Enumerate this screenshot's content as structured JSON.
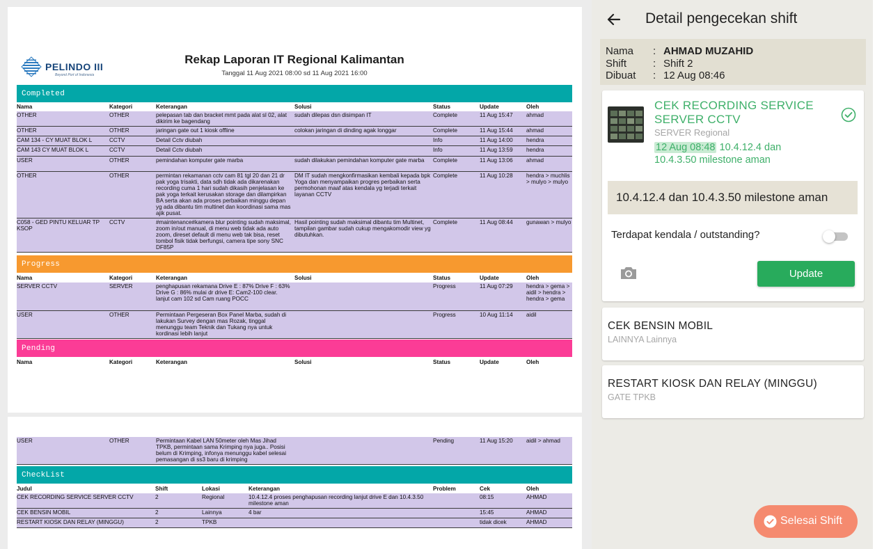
{
  "report": {
    "logo": {
      "name": "PELINDO III",
      "tagline": "Beyond Port of Indonesia"
    },
    "title": "Rekap Laporan IT Regional Kalimantan",
    "subtitle": "Tanggal 11 Aug 2021 08:00 sd 11 Aug 2021 16:00",
    "columns": {
      "nama": "Nama",
      "kategori": "Kategori",
      "keterangan": "Keterangan",
      "solusi": "Solusi",
      "status": "Status",
      "update": "Update",
      "oleh": "Oleh"
    },
    "sections": {
      "completed": {
        "label": "Completed",
        "rows": [
          {
            "nama": "OTHER",
            "kategori": "OTHER",
            "keterangan": "pelepasan tab dan bracket mmt pada alat sl 02, alat dikirim ke bagendang",
            "solusi": "sudah dilepas dsn disimpan IT",
            "status": "Complete",
            "update": "11 Aug 15:47",
            "oleh": "ahmad"
          },
          {
            "nama": "OTHER",
            "kategori": "OTHER",
            "keterangan": "jaringan gate out 1 kiosk offline",
            "solusi": "colokan jaringan di dinding agak longgar",
            "status": "Complete",
            "update": "11 Aug 15:44",
            "oleh": "ahmad"
          },
          {
            "nama": "CAM 134 - CY MUAT BLOK L",
            "kategori": "CCTV",
            "keterangan": "Detail Cctv diubah",
            "solusi": "",
            "status": "Info",
            "update": "11 Aug 14:00",
            "oleh": "hendra"
          },
          {
            "nama": "CAM 143 CY MUAT BLOK L",
            "kategori": "CCTV",
            "keterangan": "Detail Cctv diubah",
            "solusi": "",
            "status": "Info",
            "update": "11 Aug 13:59",
            "oleh": "hendra"
          },
          {
            "nama": "USER",
            "kategori": "OTHER",
            "keterangan": "pemindahan komputer gate marba",
            "solusi": "sudah dilakukan pemindahan komputer gate marba",
            "status": "Complete",
            "update": "11 Aug 13:06",
            "oleh": "ahmad"
          },
          {
            "nama": "OTHER",
            "kategori": "OTHER",
            "keterangan": "permintan rekamanan cctv cam 81 tgl 20 dan 21 dr pak yoga trisakti,  data sdh tidak ada dikarenakan recording cuma 1 hari sudah dikasih penjelasan ke pak yoga terkait kerusakan storage dan dilampirkan BA serta akan ada proses perbaikan minggu depan yg ada dibantu tim multinet dan koordinasi sama mas ajik pusat.",
            "solusi": "DM IT sudah mengkonfirmasikan kembali kepada bpk Yoga dan menyampaikan progres perbaikan serta permohonan maaf atas kendala yg terjadi terkait layanan CCTV",
            "status": "Complete",
            "update": "11 Aug 10:28",
            "oleh": "hendra > muchlis > mulyo > mulyo"
          },
          {
            "nama": "C058 - GED PINTU KELUAR TP KSOP",
            "kategori": "CCTV",
            "keterangan": "#maintenance#kamera blur pointing sudah maksimal, zoom in/out manual, di menu web tidak ada auto zoom, direset default di menu web tak bisa, reset tombol fisik tidak berfungsi, camera tipe sony SNC DF85P",
            "solusi": "Hasil pointing sudah maksimal dibantu tim Multinet, tampilan gambar sudah cukup mengakomodir view yg dibutuhkan.",
            "status": "Complete",
            "update": "11 Aug 08:44",
            "oleh": "gunawan > mulyo"
          }
        ]
      },
      "progress": {
        "label": "Progress",
        "rows": [
          {
            "nama": "SERVER CCTV",
            "kategori": "SERVER",
            "keterangan": "penghapusan rekamana Drive E : 87% Drive F : 63% Drive G : 86%  mulai dr drive E: Cam2-100 clear. lanjut cam 102 sd Cam ruang POCC",
            "solusi": "",
            "status": "Progress",
            "update": "11 Aug 07:29",
            "oleh": "hendra > gema > aidil > hendra > hendra > gema"
          },
          {
            "nama": "USER",
            "kategori": "OTHER",
            "keterangan": "Permintaan Pergeseran Box Panel Marba, sudah di lakukan Survey dengan mas Rozak, tinggal menunggu team Teknik dan Tukang nya untuk kordinasi lebih lanjut",
            "solusi": "",
            "status": "Progress",
            "update": "10 Aug 11:14",
            "oleh": "aidil"
          }
        ]
      },
      "pending": {
        "label": "Pending",
        "rows": [
          {
            "nama": "USER",
            "kategori": "OTHER",
            "keterangan": "Permintaan Kabel LAN 50meter oleh Mas Jihad TPKB, permintaan sama Krimping nya juga.. Posisi belum di Krimping, infonya menunggu kabel selesai pemasangan di ss3 baru di krimping",
            "solusi": "",
            "status": "Pending",
            "update": "11 Aug 15:20",
            "oleh": "aidil > ahmad"
          }
        ]
      },
      "checklist": {
        "label": "CheckList",
        "columns": {
          "judul": "Judul",
          "shift": "Shift",
          "lokasi": "Lokasi",
          "keterangan": "Keterangan",
          "problem": "Problem",
          "cek": "Cek",
          "oleh": "Oleh"
        },
        "rows": [
          {
            "judul": "CEK RECORDING SERVICE SERVER CCTV",
            "shift": "2",
            "lokasi": "Regional",
            "keterangan": "10.4.12.4  proses penghapusan recording lanjut drive E dan 10.4.3.50 milestone aman",
            "problem": "",
            "cek": "08:15",
            "oleh": "AHMAD"
          },
          {
            "judul": "CEK BENSIN MOBIL",
            "shift": "2",
            "lokasi": "Lainnya",
            "keterangan": "4 bar",
            "problem": "",
            "cek": "15:45",
            "oleh": "AHMAD"
          },
          {
            "judul": "RESTART KIOSK DAN RELAY (MINGGU)",
            "shift": "2",
            "lokasi": "TPKB",
            "keterangan": "",
            "problem": "",
            "cek": "tidak dicek",
            "oleh": "AHMAD"
          }
        ]
      }
    }
  },
  "detail": {
    "title": "Detail pengecekan shift",
    "info": {
      "nama_label": "Nama",
      "nama": "AHMAD MUZAHID",
      "shift_label": "Shift",
      "shift": "Shift 2",
      "dibuat_label": "Dibuat",
      "dibuat": "12 Aug 08:46",
      "colon": ":"
    },
    "active_task": {
      "title": "CEK RECORDING SERVICE SERVER CCTV",
      "subtitle": "SERVER Regional",
      "time": "12 Aug 08:48",
      "note": "10.4.12.4 dan 10.4.3.50 milestone aman",
      "answer": "10.4.12.4 dan 10.4.3.50 milestone aman",
      "kendala_label": "Terdapat kendala / outstanding?",
      "kendala_on": false,
      "update_label": "Update"
    },
    "tasks": [
      {
        "title": "CEK BENSIN MOBIL",
        "subtitle": "LAINNYA Lainnya"
      },
      {
        "title": "RESTART KIOSK DAN RELAY (MINGGU)",
        "subtitle": "GATE TPKB"
      }
    ],
    "finish_label": "Selesai Shift",
    "colors": {
      "green": "#3fb06a",
      "button_green": "#28ab5c",
      "finish": "#f58a6f",
      "teal": "#03a7a8",
      "orange": "#f7992f",
      "pink": "#fb3c96",
      "row": "#d2c7e9"
    }
  }
}
